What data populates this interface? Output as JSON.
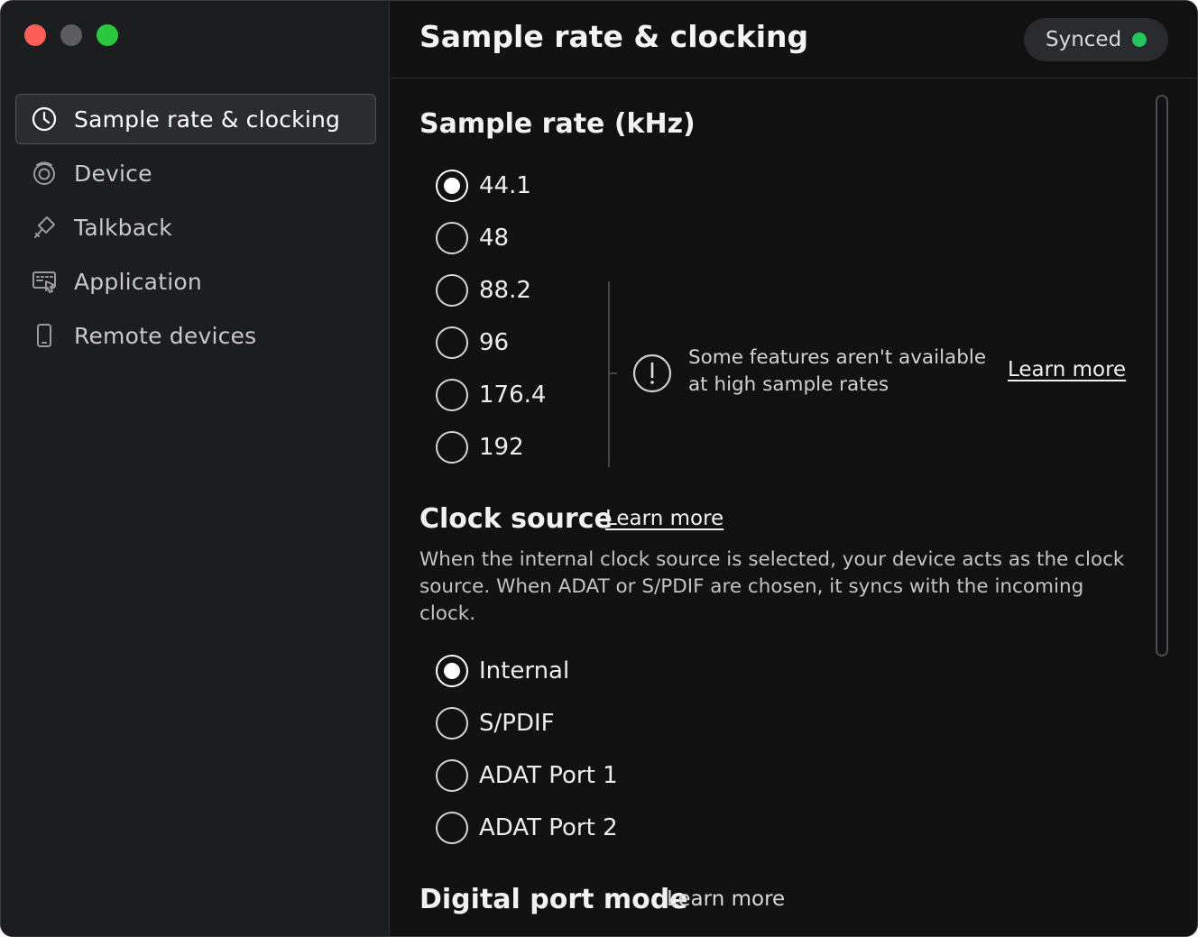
{
  "window": {
    "title": "Sample rate & clocking",
    "status": "Synced",
    "status_color": "#22c55e"
  },
  "sidebar": {
    "items": [
      {
        "label": "Sample rate & clocking",
        "icon": "clock-icon",
        "active": true
      },
      {
        "label": "Device",
        "icon": "device-icon",
        "active": false
      },
      {
        "label": "Talkback",
        "icon": "microphone-icon",
        "active": false
      },
      {
        "label": "Application",
        "icon": "application-icon",
        "active": false
      },
      {
        "label": "Remote devices",
        "icon": "phone-icon",
        "active": false
      }
    ]
  },
  "sample_rate": {
    "title": "Sample rate (kHz)",
    "options": [
      "44.1",
      "48",
      "88.2",
      "96",
      "176.4",
      "192"
    ],
    "selected": "44.1",
    "notice": "Some features aren't available at high sample rates",
    "notice_link": "Learn more"
  },
  "clock_source": {
    "title": "Clock source",
    "link": "Learn more",
    "description": "When the internal clock source is selected, your device acts as the clock source. When ADAT or S/PDIF are chosen, it syncs with the incoming clock.",
    "options": [
      "Internal",
      "S/PDIF",
      "ADAT Port 1",
      "ADAT Port 2"
    ],
    "selected": "Internal"
  },
  "digital_port_mode": {
    "title": "Digital port mode",
    "link": "Learn more"
  }
}
